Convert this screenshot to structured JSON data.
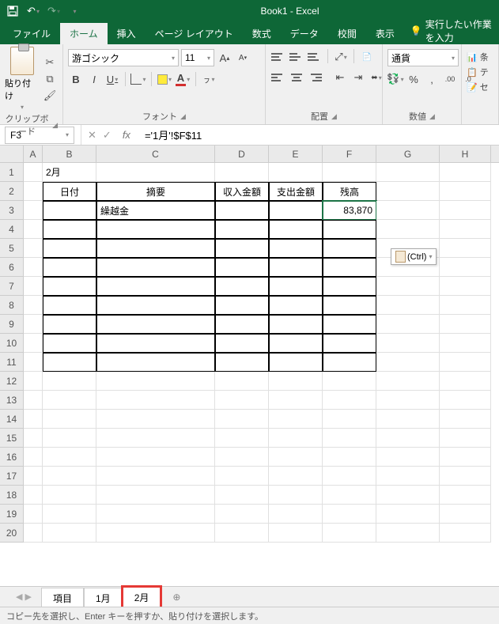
{
  "app": {
    "title": "Book1  -  Excel"
  },
  "tabs": {
    "file": "ファイル",
    "home": "ホーム",
    "insert": "挿入",
    "pagelayout": "ページ レイアウト",
    "formulas": "数式",
    "data": "データ",
    "review": "校閲",
    "view": "表示",
    "tellme": "実行したい作業を入力"
  },
  "ribbon": {
    "clipboard": {
      "paste": "貼り付け",
      "label": "クリップボード"
    },
    "font": {
      "name": "游ゴシック",
      "size": "11",
      "label": "フォント"
    },
    "align": {
      "label": "配置",
      "wrap": "折り返して全体を表示する",
      "merge": "セルを結合して中央揃え"
    },
    "number": {
      "format": "通貨",
      "label": "数値"
    },
    "styles": {
      "cond": "条"
    }
  },
  "namebox": "F3",
  "formula": "='1月'!$F$11",
  "cols": [
    "A",
    "B",
    "C",
    "D",
    "E",
    "F",
    "G",
    "H"
  ],
  "colw": {
    "A": 24,
    "B": 68,
    "C": 150,
    "D": 68,
    "E": 68,
    "F": 68,
    "G": 80,
    "H": 65
  },
  "sheet": {
    "B1": "2月",
    "hdr": {
      "B2": "日付",
      "C2": "摘要",
      "D2": "収入金額",
      "E2": "支出金額",
      "F2": "残高"
    },
    "C3": "繰越金",
    "F3": "83,870"
  },
  "paste_tag": "(Ctrl)",
  "sheets": {
    "s1": "項目",
    "s2": "1月",
    "s3": "2月"
  },
  "status": "コピー先を選択し、Enter キーを押すか、貼り付けを選択します。",
  "chart_data": null
}
